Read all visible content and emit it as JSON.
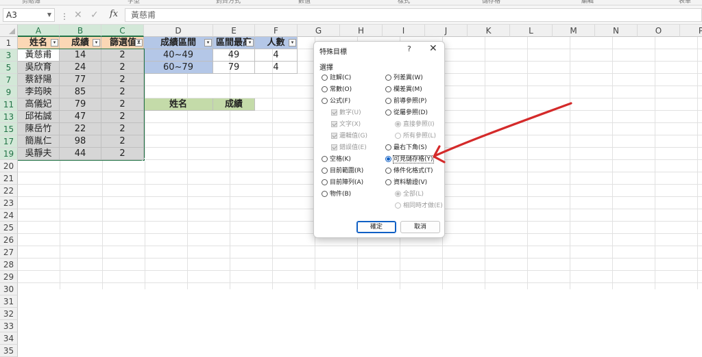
{
  "ribbon": {
    "groups": [
      "剪貼簿",
      "字型",
      "對齊方式",
      "數值",
      "樣式",
      "儲存格",
      "編輯",
      "表單"
    ]
  },
  "formula_bar": {
    "name_box": "A3",
    "formula": "黃慈甫",
    "fx": "fx"
  },
  "columns": [
    "A",
    "B",
    "C",
    "D",
    "E",
    "F",
    "G",
    "H",
    "I",
    "J",
    "K",
    "L",
    "M",
    "N",
    "O",
    "P"
  ],
  "rows": [
    "1",
    "3",
    "5",
    "7",
    "9",
    "11",
    "13",
    "15",
    "17",
    "19",
    "20",
    "21",
    "22",
    "23",
    "24",
    "25",
    "26",
    "27",
    "28",
    "29",
    "30",
    "31",
    "32",
    "33",
    "34",
    "35"
  ],
  "sheet": {
    "headers": {
      "name": "姓名",
      "score": "成績",
      "filter": "篩選值"
    },
    "data_rows": [
      {
        "name": "黃慈甫",
        "score": "14",
        "filter": "2"
      },
      {
        "name": "吳欣育",
        "score": "24",
        "filter": "2"
      },
      {
        "name": "蔡舒陽",
        "score": "77",
        "filter": "2"
      },
      {
        "name": "李筠映",
        "score": "85",
        "filter": "2"
      },
      {
        "name": "高儀妃",
        "score": "79",
        "filter": "2"
      },
      {
        "name": "邱祐誠",
        "score": "47",
        "filter": "2"
      },
      {
        "name": "陳岳竹",
        "score": "22",
        "filter": "2"
      },
      {
        "name": "簡胤仁",
        "score": "98",
        "filter": "2"
      },
      {
        "name": "吳靜夫",
        "score": "44",
        "filter": "2"
      }
    ],
    "range_table": {
      "headers": [
        "成績區間",
        "區間最高",
        "人數"
      ],
      "rows": [
        [
          "40~49",
          "49",
          "4"
        ],
        [
          "60~79",
          "79",
          "4"
        ]
      ]
    },
    "result_headers": [
      "姓名",
      "成績"
    ]
  },
  "dialog": {
    "title": "特殊目標",
    "help": "?",
    "close": "✕",
    "section": "選擇",
    "left_options": [
      {
        "label": "註解(C)",
        "type": "radio",
        "enabled": true,
        "checked": false
      },
      {
        "label": "常數(O)",
        "type": "radio",
        "enabled": true,
        "checked": false
      },
      {
        "label": "公式(F)",
        "type": "radio",
        "enabled": true,
        "checked": false
      },
      {
        "label": "數字(U)",
        "type": "check",
        "enabled": false,
        "checked": true
      },
      {
        "label": "文字(X)",
        "type": "check",
        "enabled": false,
        "checked": true
      },
      {
        "label": "邏輯值(G)",
        "type": "check",
        "enabled": false,
        "checked": true
      },
      {
        "label": "錯誤值(E)",
        "type": "check",
        "enabled": false,
        "checked": true
      },
      {
        "label": "空格(K)",
        "type": "radio",
        "enabled": true,
        "checked": false
      },
      {
        "label": "目前範圍(R)",
        "type": "radio",
        "enabled": true,
        "checked": false
      },
      {
        "label": "目前陣列(A)",
        "type": "radio",
        "enabled": true,
        "checked": false
      },
      {
        "label": "物件(B)",
        "type": "radio",
        "enabled": true,
        "checked": false
      }
    ],
    "right_options": [
      {
        "label": "列差異(W)",
        "type": "radio",
        "enabled": true,
        "checked": false
      },
      {
        "label": "欄差異(M)",
        "type": "radio",
        "enabled": true,
        "checked": false
      },
      {
        "label": "前導參照(P)",
        "type": "radio",
        "enabled": true,
        "checked": false
      },
      {
        "label": "從屬參照(D)",
        "type": "radio",
        "enabled": true,
        "checked": false
      },
      {
        "label": "直接參照(I)",
        "type": "radio",
        "enabled": false,
        "checked": true
      },
      {
        "label": "所有參照(L)",
        "type": "radio",
        "enabled": false,
        "checked": false
      },
      {
        "label": "最右下角(S)",
        "type": "radio",
        "enabled": true,
        "checked": false
      },
      {
        "label": "可見儲存格(Y)",
        "type": "radio",
        "enabled": true,
        "checked": true
      },
      {
        "label": "條件化格式(T)",
        "type": "radio",
        "enabled": true,
        "checked": false
      },
      {
        "label": "資料驗證(V)",
        "type": "radio",
        "enabled": true,
        "checked": false
      },
      {
        "label": "全部(L)",
        "type": "radio",
        "enabled": false,
        "checked": true
      },
      {
        "label": "相同時才做(E)",
        "type": "radio",
        "enabled": false,
        "checked": false
      }
    ],
    "ok": "確定",
    "cancel": "取消"
  },
  "colors": {
    "accent": "#217346",
    "peach": "#fbd7b5",
    "blue": "#b4c7e7",
    "green": "#c4dba9",
    "arrow": "#d42a2a",
    "radio_on": "#0f5fc4"
  }
}
